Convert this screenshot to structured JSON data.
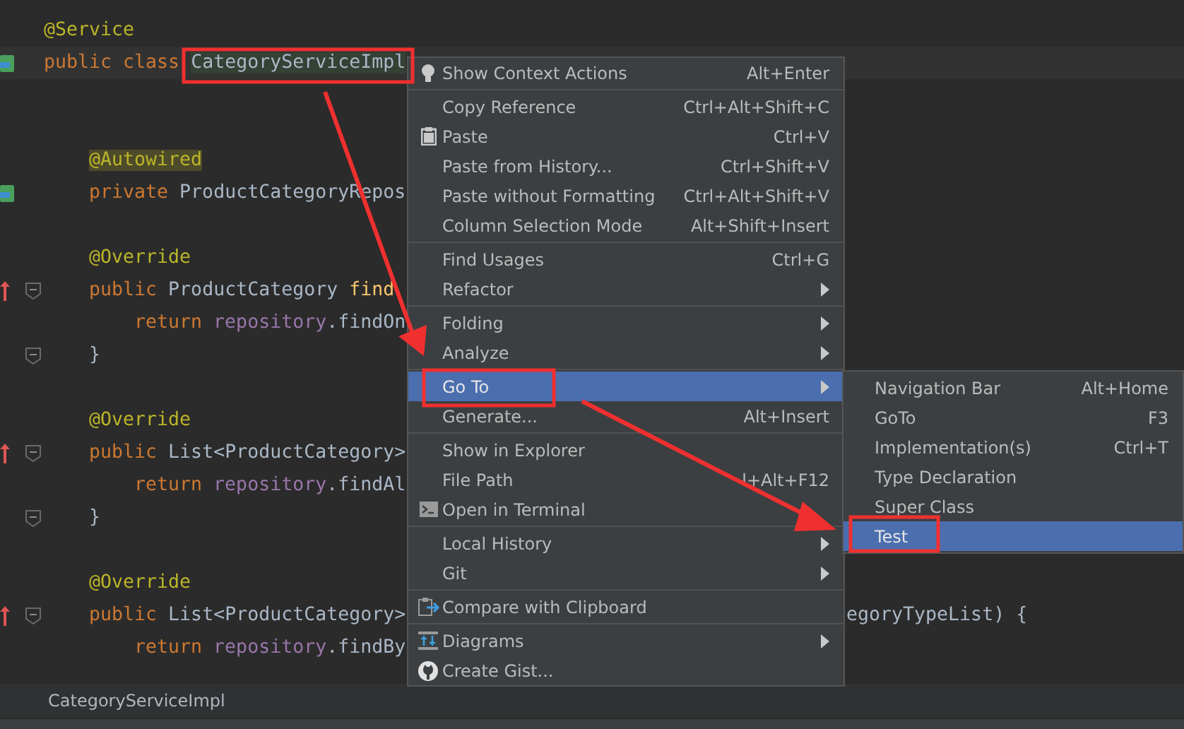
{
  "editor": {
    "lines": [
      {
        "kind": "top",
        "tokens": [
          {
            "kind": "annotation",
            "text": "@Service"
          }
        ]
      },
      {
        "kind": "top",
        "caret": true,
        "tokens": [
          {
            "kind": "keyword",
            "text": "public class "
          },
          {
            "kind": "plain",
            "text": "CategoryServiceImpl",
            "highlight": true
          }
        ]
      },
      {
        "kind": "blank"
      },
      {
        "kind": "blank"
      },
      {
        "kind": "member",
        "tokens": [
          {
            "kind": "annotation",
            "text": "@Autowired",
            "highlight": true
          }
        ]
      },
      {
        "kind": "member",
        "tokens": [
          {
            "kind": "keyword",
            "text": "private "
          },
          {
            "kind": "plain",
            "text": "ProductCategoryRepos"
          }
        ]
      },
      {
        "kind": "blank"
      },
      {
        "kind": "member",
        "tokens": [
          {
            "kind": "annotation",
            "text": "@Override"
          }
        ]
      },
      {
        "kind": "member",
        "fold": true,
        "tokens": [
          {
            "kind": "keyword",
            "text": "public "
          },
          {
            "kind": "plain",
            "text": "ProductCategory "
          },
          {
            "kind": "method",
            "text": "find"
          }
        ]
      },
      {
        "kind": "body",
        "tokens": [
          {
            "kind": "keyword",
            "text": "return "
          },
          {
            "kind": "field",
            "text": "repository"
          },
          {
            "kind": "plain",
            "text": ".findOn"
          }
        ]
      },
      {
        "kind": "member",
        "fold": true,
        "tokens": [
          {
            "kind": "plain",
            "text": "}"
          }
        ]
      },
      {
        "kind": "blank"
      },
      {
        "kind": "member",
        "tokens": [
          {
            "kind": "annotation",
            "text": "@Override"
          }
        ]
      },
      {
        "kind": "member",
        "fold": true,
        "tokens": [
          {
            "kind": "keyword",
            "text": "public "
          },
          {
            "kind": "plain",
            "text": "List<ProductCategory>"
          }
        ]
      },
      {
        "kind": "body",
        "tokens": [
          {
            "kind": "keyword",
            "text": "return "
          },
          {
            "kind": "field",
            "text": "repository"
          },
          {
            "kind": "plain",
            "text": ".findAl"
          }
        ]
      },
      {
        "kind": "member",
        "fold": true,
        "tokens": [
          {
            "kind": "plain",
            "text": "}"
          }
        ]
      },
      {
        "kind": "blank"
      },
      {
        "kind": "member",
        "tokens": [
          {
            "kind": "annotation",
            "text": "@Override"
          }
        ]
      },
      {
        "kind": "member",
        "fold": true,
        "tokens": [
          {
            "kind": "keyword",
            "text": "public "
          },
          {
            "kind": "plain",
            "text": "List<ProductCategory>"
          }
        ],
        "tail": "egoryTypeList) {"
      },
      {
        "kind": "body",
        "tokens": [
          {
            "kind": "keyword",
            "text": "return "
          },
          {
            "kind": "field",
            "text": "repository"
          },
          {
            "kind": "plain",
            "text": ".findBy"
          }
        ]
      }
    ]
  },
  "breadcrumb": "CategoryServiceImpl",
  "context_menu": [
    {
      "kind": "item",
      "label": "Show Context Actions",
      "shortcut": "Alt+Enter",
      "selected": false
    },
    {
      "kind": "separator"
    },
    {
      "kind": "item",
      "label": "Copy Reference",
      "shortcut": "Ctrl+Alt+Shift+C",
      "selected": false
    },
    {
      "kind": "item",
      "label": "Paste",
      "shortcut": "Ctrl+V",
      "selected": false
    },
    {
      "kind": "item",
      "label": "Paste from History...",
      "shortcut": "Ctrl+Shift+V",
      "selected": false
    },
    {
      "kind": "item",
      "label": "Paste without Formatting",
      "shortcut": "Ctrl+Alt+Shift+V",
      "selected": false
    },
    {
      "kind": "item",
      "label": "Column Selection Mode",
      "shortcut": "Alt+Shift+Insert",
      "selected": false
    },
    {
      "kind": "separator"
    },
    {
      "kind": "item",
      "label": "Find Usages",
      "shortcut": "Ctrl+G",
      "selected": false
    },
    {
      "kind": "item",
      "label": "Refactor",
      "submenu": true,
      "selected": false
    },
    {
      "kind": "separator"
    },
    {
      "kind": "item",
      "label": "Folding",
      "submenu": true,
      "selected": false
    },
    {
      "kind": "item",
      "label": "Analyze",
      "submenu": true,
      "selected": false
    },
    {
      "kind": "separator"
    },
    {
      "kind": "item",
      "label": "Go To",
      "submenu": true,
      "selected": true
    },
    {
      "kind": "item",
      "label": "Generate...",
      "shortcut": "Alt+Insert",
      "selected": false
    },
    {
      "kind": "separator"
    },
    {
      "kind": "item",
      "label": "Show in Explorer",
      "selected": false
    },
    {
      "kind": "item",
      "label": "File Path",
      "shortcut": "l+Alt+F12",
      "selected": false
    },
    {
      "kind": "item",
      "label": "Open in Terminal",
      "selected": false
    },
    {
      "kind": "separator"
    },
    {
      "kind": "item",
      "label": "Local History",
      "submenu": true,
      "selected": false
    },
    {
      "kind": "item",
      "label": "Git",
      "submenu": true,
      "selected": false
    },
    {
      "kind": "separator"
    },
    {
      "kind": "item",
      "label": "Compare with Clipboard",
      "selected": false
    },
    {
      "kind": "separator"
    },
    {
      "kind": "item",
      "label": "Diagrams",
      "submenu": true,
      "selected": false
    },
    {
      "kind": "item",
      "label": "Create Gist...",
      "selected": false
    }
  ],
  "submenu": [
    {
      "label": "Navigation Bar",
      "shortcut": "Alt+Home",
      "selected": false
    },
    {
      "label": "GoTo",
      "shortcut": "F3",
      "selected": false
    },
    {
      "label": "Implementation(s)",
      "shortcut": "Ctrl+T",
      "selected": false
    },
    {
      "label": "Type Declaration",
      "selected": false
    },
    {
      "label": "Super Class",
      "selected": false
    },
    {
      "label": "Test",
      "selected": true
    }
  ]
}
